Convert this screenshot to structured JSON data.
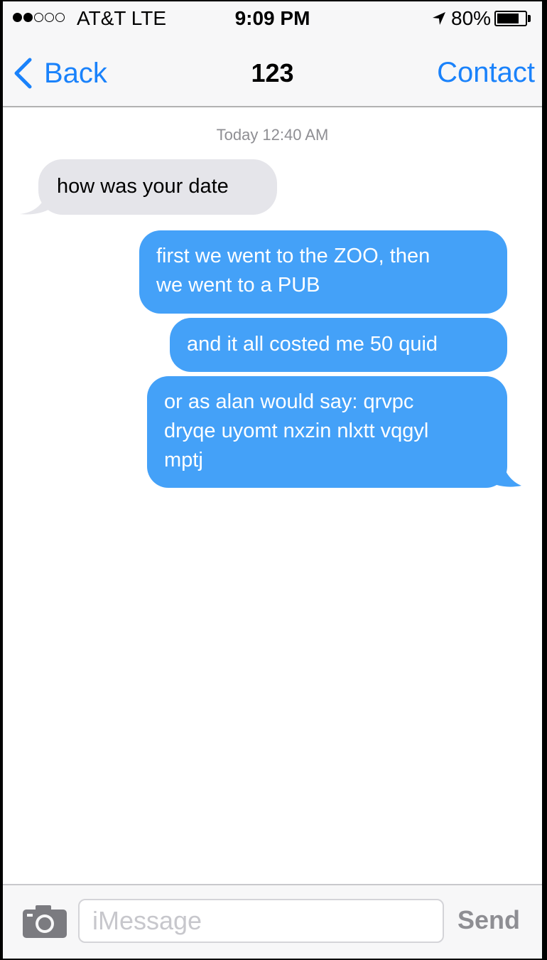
{
  "status_bar": {
    "signal": {
      "filled": 2,
      "total": 5
    },
    "carrier": "AT&T LTE",
    "time": "9:09 PM",
    "location_icon": "location-arrow-icon",
    "battery_text": "80%",
    "battery_level": 0.8
  },
  "nav": {
    "back_label": "Back",
    "back_icon": "chevron-left-icon",
    "title": "123",
    "contact_label": "Contact"
  },
  "conversation": {
    "timestamp": "Today 12:40 AM",
    "messages": [
      {
        "direction": "incoming",
        "text": "how was your date"
      },
      {
        "direction": "outgoing",
        "lines": [
          "first we went to the ZOO, then",
          "we went to a PUB"
        ]
      },
      {
        "direction": "outgoing",
        "text": "and it all costed me 50 quid"
      },
      {
        "direction": "outgoing",
        "lines": [
          "or as alan would say: qrvpc",
          "dryqe uyomt nxzin nlxtt vqgyl",
          "mptj"
        ]
      }
    ]
  },
  "input_bar": {
    "camera_icon": "camera-icon",
    "placeholder": "iMessage",
    "value": "",
    "send_label": "Send"
  },
  "colors": {
    "accent": "#1a82fb",
    "outgoing_bubble": "#44a1f8",
    "incoming_bubble": "#e5e5ea",
    "bar_background": "#f7f7f8"
  }
}
